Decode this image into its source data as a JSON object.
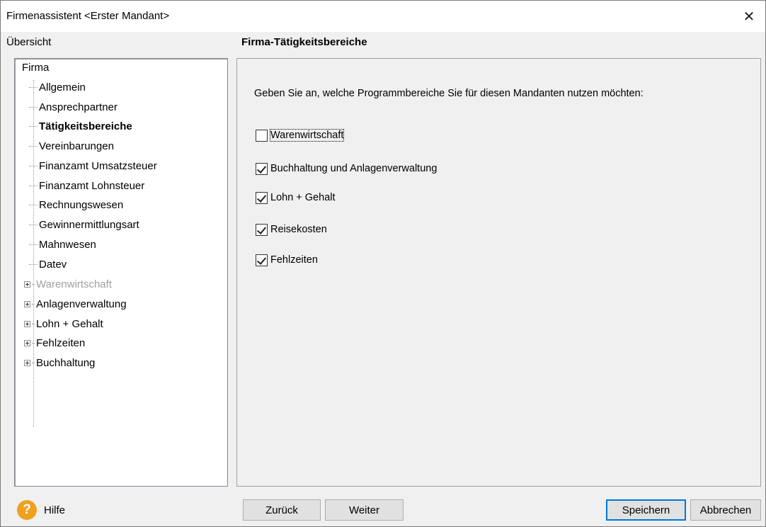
{
  "window": {
    "title": "Firmenassistent <Erster Mandant>",
    "close_glyph": "✕"
  },
  "sidebar": {
    "header": "Übersicht",
    "root": "Firma",
    "items": [
      {
        "label": "Allgemein",
        "expandable": false
      },
      {
        "label": "Ansprechpartner",
        "expandable": false
      },
      {
        "label": "Tätigkeitsbereiche",
        "expandable": false,
        "selected": true
      },
      {
        "label": "Vereinbarungen",
        "expandable": false
      },
      {
        "label": "Finanzamt Umsatzsteuer",
        "expandable": false
      },
      {
        "label": "Finanzamt Lohnsteuer",
        "expandable": false
      },
      {
        "label": "Rechnungswesen",
        "expandable": false
      },
      {
        "label": "Gewinnermittlungsart",
        "expandable": false
      },
      {
        "label": "Mahnwesen",
        "expandable": false
      },
      {
        "label": "Datev",
        "expandable": false
      },
      {
        "label": "Warenwirtschaft",
        "expandable": true,
        "disabled": true
      },
      {
        "label": "Anlagenverwaltung",
        "expandable": true
      },
      {
        "label": "Lohn + Gehalt",
        "expandable": true
      },
      {
        "label": "Fehlzeiten",
        "expandable": true
      },
      {
        "label": "Buchhaltung",
        "expandable": true
      }
    ]
  },
  "main": {
    "title": "Firma-Tätigkeitsbereiche",
    "intro": "Geben Sie an, welche Programmbereiche Sie für diesen Mandanten nutzen möchten:",
    "options": [
      {
        "label": "Warenwirtschaft",
        "checked": false
      },
      {
        "label": "Buchhaltung und Anlagenverwaltung",
        "checked": true
      },
      {
        "label": "Lohn + Gehalt",
        "checked": true
      },
      {
        "label": "Reisekosten",
        "checked": true
      },
      {
        "label": "Fehlzeiten",
        "checked": true
      }
    ]
  },
  "footer": {
    "help_label": "Hilfe",
    "help_glyph": "?",
    "back_label": "Zurück",
    "next_label": "Weiter",
    "save_label": "Speichern",
    "cancel_label": "Abbrechen"
  },
  "colors": {
    "accent": "#0078d7",
    "help_icon": "#f0a020"
  }
}
